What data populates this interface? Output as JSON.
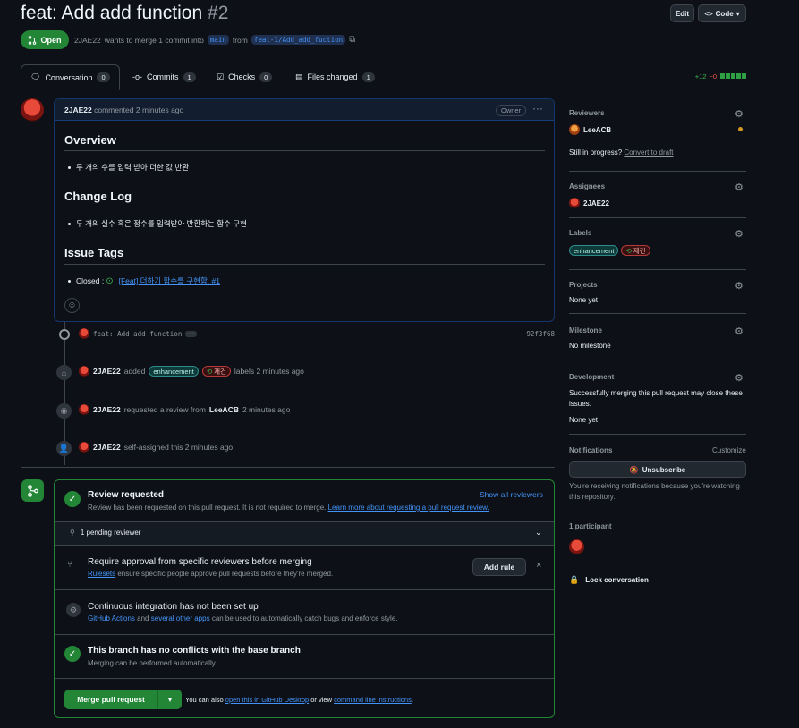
{
  "pr": {
    "title": "feat: Add add function",
    "number": "#2",
    "status": "Open",
    "author": "2JAE22",
    "meta_text": "wants to merge 1 commit into",
    "base_branch": "main",
    "from_text": "from",
    "head_branch": "feat-1/Add_add_fuction"
  },
  "header": {
    "edit_label": "Edit",
    "code_label": "Code"
  },
  "tabs": [
    {
      "label": "Conversation",
      "count": "0"
    },
    {
      "label": "Commits",
      "count": "1"
    },
    {
      "label": "Checks",
      "count": "0"
    },
    {
      "label": "Files changed",
      "count": "1"
    }
  ],
  "diffstat": {
    "additions": "+12",
    "deletions": "−0"
  },
  "comment": {
    "author": "2JAE22",
    "action": "commented 2 minutes ago",
    "role": "Owner",
    "sections": {
      "overview_title": "Overview",
      "overview_item": "두 개의 수를 입력 받아 더한 값 반환",
      "changelog_title": "Change Log",
      "changelog_item": "두 개의 실수 혹은 정수를 입력받아 반환하는 함수 구현",
      "issue_title": "Issue Tags",
      "issue_prefix": "Closed : ",
      "issue_link": "[Feat] 더하기 함수를 구현함. #1"
    }
  },
  "timeline": {
    "commit_message": "feat: Add add function",
    "commit_sha": "92f3f68",
    "label_event": {
      "actor": "2JAE22",
      "verb": "added",
      "label1": "enhancement",
      "label2": "재건",
      "suffix": "labels 2 minutes ago"
    },
    "review_event": {
      "actor": "2JAE22",
      "verb": "requested a review from",
      "target": "LeeACB",
      "suffix": "2 minutes ago"
    },
    "assign_event": {
      "actor": "2JAE22",
      "text": "self-assigned this 2 minutes ago"
    }
  },
  "merge": {
    "review_title": "Review requested",
    "review_sub": "Review has been requested on this pull request. It is not required to merge.",
    "review_link": "Learn more about requesting a pull request review.",
    "show_all": "Show all reviewers",
    "pending": "1 pending reviewer",
    "approval_title": "Require approval from specific reviewers before merging",
    "approval_link": "Rulesets",
    "approval_sub": "ensure specific people approve pull requests before they're merged.",
    "add_rule": "Add rule",
    "ci_title": "Continuous integration has not been set up",
    "ci_link1": "GitHub Actions",
    "ci_and": "and",
    "ci_link2": "several other apps",
    "ci_sub": "can be used to automatically catch bugs and enforce style.",
    "conflict_title": "This branch has no conflicts with the base branch",
    "conflict_sub": "Merging can be performed automatically.",
    "merge_button": "Merge pull request",
    "also_text": "You can also",
    "desktop_link": "open this in GitHub Desktop",
    "or_view": "or view",
    "cli_link": "command line instructions",
    "period": "."
  },
  "sidebar": {
    "reviewers_label": "Reviewers",
    "reviewer": "LeeACB",
    "still_progress": "Still in progress?",
    "convert_draft": "Convert to draft",
    "assignees_label": "Assignees",
    "assignee": "2JAE22",
    "labels_label": "Labels",
    "label1": "enhancement",
    "label2": "재건",
    "projects_label": "Projects",
    "projects_value": "None yet",
    "milestone_label": "Milestone",
    "milestone_value": "No milestone",
    "development_label": "Development",
    "development_text": "Successfully merging this pull request may close these issues.",
    "development_value": "None yet",
    "notifications_label": "Notifications",
    "customize": "Customize",
    "unsubscribe": "Unsubscribe",
    "notif_text": "You're receiving notifications because you're watching this repository.",
    "participants_label": "1 participant",
    "lock": "Lock conversation"
  },
  "colors": {
    "accent": "#4493f8",
    "success": "#238636",
    "background": "#0d1117"
  }
}
